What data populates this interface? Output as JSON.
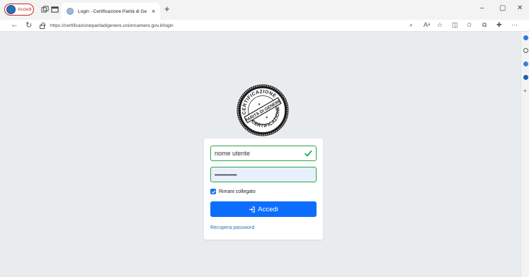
{
  "browser": {
    "profile_label": "Accedi",
    "tab_title": "Login - Certificazione Parità di Ge",
    "tab_close": "×",
    "new_tab": "+",
    "url": "https://certificazioneparitadigenere.unioncamere.gov.it/login",
    "win_min": "–",
    "win_max": "▢",
    "win_close": "✕"
  },
  "logo": {
    "text_top": "CERTIFICAZIONE",
    "text_mid": "PARITÀ DI GENERE",
    "text_bottom": "CERTIFICAZIONE"
  },
  "login": {
    "username_value": "nome utente",
    "password_value": "••••••••••••••••",
    "remember_label": "Rimani collegato",
    "remember_checked": true,
    "submit_label": "Accedi",
    "recover_label": "Recupera password"
  },
  "icons": {
    "profile": "profile-avatar-icon",
    "collections": "collections-icon",
    "tab_actions": "tab-actions-icon",
    "back": "back-arrow-icon",
    "refresh": "refresh-icon",
    "lock": "lock-icon",
    "read_aloud": "read-aloud-icon",
    "text_size": "text-size-icon",
    "favorite": "star-icon",
    "split": "split-screen-icon",
    "favorites": "favorites-icon",
    "collections_btn": "collections-icon",
    "extensions": "extensions-icon",
    "more": "more-icon",
    "valid": "check-icon",
    "signin": "sign-in-icon"
  },
  "colors": {
    "primary": "#0d6efd",
    "valid": "#28a745",
    "page_bg": "#e9ecef",
    "autofill": "#e8f0fe"
  }
}
